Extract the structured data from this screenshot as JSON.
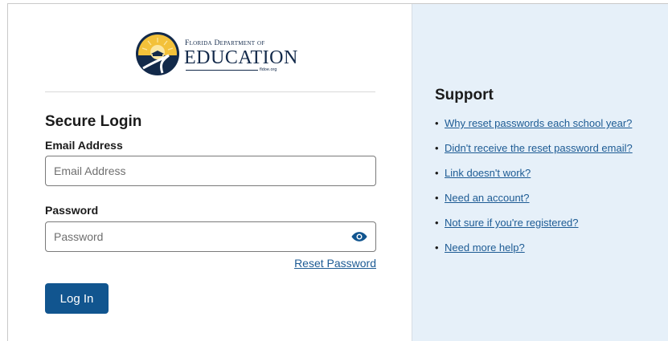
{
  "logo": {
    "line1": "Florida Department of",
    "line2": "EDUCATION",
    "url": "fldoe.org"
  },
  "login": {
    "title": "Secure Login",
    "email_label": "Email Address",
    "email_placeholder": "Email Address",
    "email_value": "",
    "password_label": "Password",
    "password_placeholder": "Password",
    "password_value": "",
    "reset_link": "Reset Password",
    "submit_label": "Log In"
  },
  "support": {
    "title": "Support",
    "links": [
      "Why reset passwords each school year?",
      "Didn't receive the reset password email?",
      "Link doesn't work?",
      "Need an account?",
      "Not sure if you're registered?",
      "Need more help?"
    ]
  },
  "colors": {
    "primary_button": "#11558f",
    "link": "#1d5b94",
    "support_panel_bg": "#e6f0f9",
    "logo_navy": "#12294a",
    "logo_gold": "#e8a817"
  },
  "icons": {
    "password_toggle": "eye-icon",
    "logo_seal": "sunrise-road-seal"
  }
}
